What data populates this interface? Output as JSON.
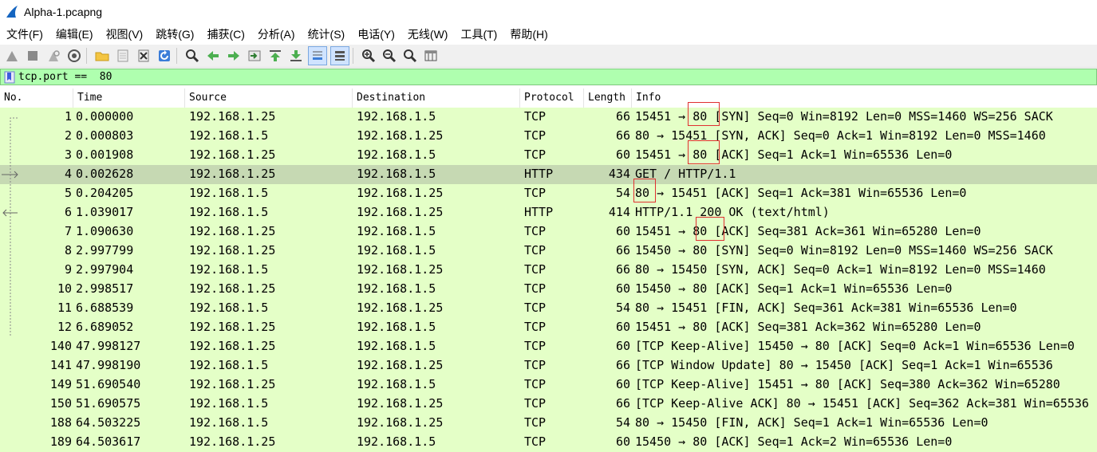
{
  "window": {
    "title": "Alpha-1.pcapng"
  },
  "menu": [
    "文件(F)",
    "编辑(E)",
    "视图(V)",
    "跳转(G)",
    "捕获(C)",
    "分析(A)",
    "统计(S)",
    "电话(Y)",
    "无线(W)",
    "工具(T)",
    "帮助(H)"
  ],
  "toolbar_icons": [
    "shark-fin-start-icon",
    "stop-icon",
    "restart-icon",
    "options-icon",
    "open-folder-icon",
    "file-icon",
    "close-file-icon",
    "reload-icon",
    "search-icon",
    "back-arrow-icon",
    "forward-arrow-icon",
    "go-to-packet-icon",
    "first-packet-icon",
    "last-packet-icon",
    "autoscroll-icon",
    "colorize-icon",
    "zoom-in-icon",
    "zoom-out-icon",
    "zoom-normal-icon",
    "resize-columns-icon"
  ],
  "filter": {
    "value": "tcp.port ==  80"
  },
  "columns": [
    "No.",
    "Time",
    "Source",
    "Destination",
    "Protocol",
    "Length",
    "Info"
  ],
  "packets": [
    {
      "no": "1",
      "time": "0.000000",
      "src": "192.168.1.25",
      "dst": "192.168.1.5",
      "proto": "TCP",
      "len": "66",
      "info": "15451 → 80 [SYN] Seq=0 Win=8192 Len=0 MSS=1460 WS=256 SACK"
    },
    {
      "no": "2",
      "time": "0.000803",
      "src": "192.168.1.5",
      "dst": "192.168.1.25",
      "proto": "TCP",
      "len": "66",
      "info": "80 → 15451 [SYN, ACK] Seq=0 Ack=1 Win=8192 Len=0 MSS=1460"
    },
    {
      "no": "3",
      "time": "0.001908",
      "src": "192.168.1.25",
      "dst": "192.168.1.5",
      "proto": "TCP",
      "len": "60",
      "info": "15451 → 80 [ACK] Seq=1 Ack=1 Win=65536 Len=0"
    },
    {
      "no": "4",
      "time": "0.002628",
      "src": "192.168.1.25",
      "dst": "192.168.1.5",
      "proto": "HTTP",
      "len": "434",
      "info": "GET / HTTP/1.1"
    },
    {
      "no": "5",
      "time": "0.204205",
      "src": "192.168.1.5",
      "dst": "192.168.1.25",
      "proto": "TCP",
      "len": "54",
      "info": "80 → 15451 [ACK] Seq=1 Ack=381 Win=65536 Len=0"
    },
    {
      "no": "6",
      "time": "1.039017",
      "src": "192.168.1.5",
      "dst": "192.168.1.25",
      "proto": "HTTP",
      "len": "414",
      "info": "HTTP/1.1 200 OK  (text/html)"
    },
    {
      "no": "7",
      "time": "1.090630",
      "src": "192.168.1.25",
      "dst": "192.168.1.5",
      "proto": "TCP",
      "len": "60",
      "info": "15451 → 80 [ACK] Seq=381 Ack=361 Win=65280 Len=0"
    },
    {
      "no": "8",
      "time": "2.997799",
      "src": "192.168.1.25",
      "dst": "192.168.1.5",
      "proto": "TCP",
      "len": "66",
      "info": "15450 → 80 [SYN] Seq=0 Win=8192 Len=0 MSS=1460 WS=256 SACK"
    },
    {
      "no": "9",
      "time": "2.997904",
      "src": "192.168.1.5",
      "dst": "192.168.1.25",
      "proto": "TCP",
      "len": "66",
      "info": "80 → 15450 [SYN, ACK] Seq=0 Ack=1 Win=8192 Len=0 MSS=1460"
    },
    {
      "no": "10",
      "time": "2.998517",
      "src": "192.168.1.25",
      "dst": "192.168.1.5",
      "proto": "TCP",
      "len": "60",
      "info": "15450 → 80 [ACK] Seq=1 Ack=1 Win=65536 Len=0"
    },
    {
      "no": "11",
      "time": "6.688539",
      "src": "192.168.1.5",
      "dst": "192.168.1.25",
      "proto": "TCP",
      "len": "54",
      "info": "80 → 15451 [FIN, ACK] Seq=361 Ack=381 Win=65536 Len=0"
    },
    {
      "no": "12",
      "time": "6.689052",
      "src": "192.168.1.25",
      "dst": "192.168.1.5",
      "proto": "TCP",
      "len": "60",
      "info": "15451 → 80 [ACK] Seq=381 Ack=362 Win=65280 Len=0"
    },
    {
      "no": "140",
      "time": "47.998127",
      "src": "192.168.1.25",
      "dst": "192.168.1.5",
      "proto": "TCP",
      "len": "60",
      "info": "[TCP Keep-Alive] 15450 → 80 [ACK] Seq=0 Ack=1 Win=65536 Len=0"
    },
    {
      "no": "141",
      "time": "47.998190",
      "src": "192.168.1.5",
      "dst": "192.168.1.25",
      "proto": "TCP",
      "len": "66",
      "info": "[TCP Window Update] 80 → 15450 [ACK] Seq=1 Ack=1 Win=65536"
    },
    {
      "no": "149",
      "time": "51.690540",
      "src": "192.168.1.25",
      "dst": "192.168.1.5",
      "proto": "TCP",
      "len": "60",
      "info": "[TCP Keep-Alive] 15451 → 80 [ACK] Seq=380 Ack=362 Win=65280"
    },
    {
      "no": "150",
      "time": "51.690575",
      "src": "192.168.1.5",
      "dst": "192.168.1.25",
      "proto": "TCP",
      "len": "66",
      "info": "[TCP Keep-Alive ACK] 80 → 15451 [ACK] Seq=362 Ack=381 Win=65536"
    },
    {
      "no": "188",
      "time": "64.503225",
      "src": "192.168.1.5",
      "dst": "192.168.1.25",
      "proto": "TCP",
      "len": "54",
      "info": "80 → 15450 [FIN, ACK] Seq=1 Ack=1 Win=65536 Len=0"
    },
    {
      "no": "189",
      "time": "64.503617",
      "src": "192.168.1.25",
      "dst": "192.168.1.5",
      "proto": "TCP",
      "len": "60",
      "info": "15450 → 80 [ACK] Seq=1 Ack=2 Win=65536 Len=0"
    }
  ],
  "colors": {
    "row_bg": "#e4ffc7",
    "selected_bg": "#c6d9b3",
    "filter_bg": "#afffaf",
    "highlight_border": "#e03030"
  }
}
